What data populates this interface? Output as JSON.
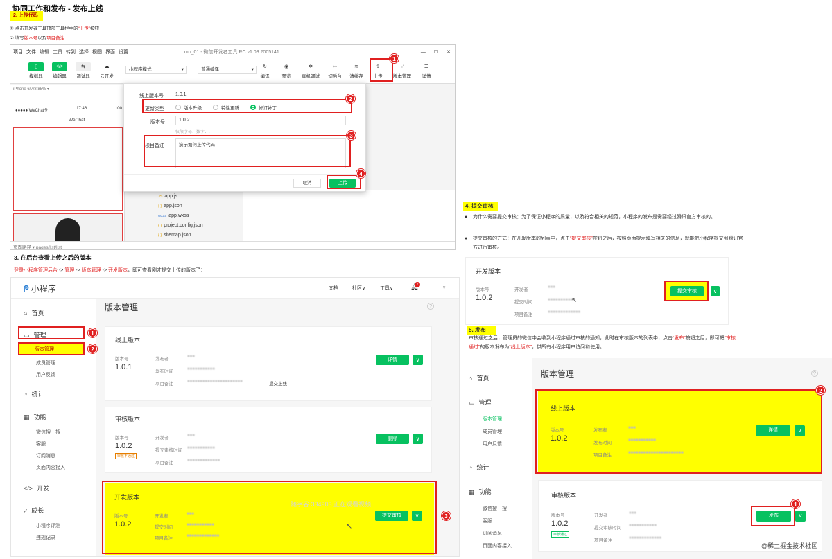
{
  "header": {
    "title": "协同工作和发布 - 发布上线",
    "step2": "2. 上传代码",
    "step2_note1_num": "①",
    "step2_note1_a": "点击开发者工具顶部工具栏中的",
    "step2_note1_b": "“上传”",
    "step2_note1_c": "按钮",
    "step2_note2_num": "②",
    "step2_note2_a": "填写",
    "step2_note2_b": "版本号",
    "step2_note2_c": "以及",
    "step2_note2_d": "项目备注"
  },
  "ide": {
    "menus": [
      "项目",
      "文件",
      "编辑",
      "工具",
      "转到",
      "选择",
      "视图",
      "界面",
      "设置",
      "..."
    ],
    "title": "mp_01 - 微信开发者工具 RC v1.03.2005141",
    "tools_left": [
      "模拟器",
      "编辑器",
      "调试器",
      "云开发"
    ],
    "mode": "小程序模式",
    "compile": "普通编译",
    "tools_right": [
      "编译",
      "预览",
      "真机调试",
      "切后台",
      "清缓存",
      "上传",
      "版本管理",
      "详情"
    ],
    "device": "iPhone 6/7/8 85% ▾",
    "wechat_carrier": "●●●●● WeChat令",
    "wechat_time": "17:46",
    "wechat_pct": "100",
    "wechat_title": "WeChat",
    "files": [
      "app.js",
      "app.json",
      "app.wxss",
      "project.config.json",
      "sitemap.json"
    ],
    "file_prefix": [
      "JS",
      "{ }",
      "wxss",
      "{ }",
      "{ }"
    ],
    "status": "页面路径 ▾   pages/list/list"
  },
  "dialog": {
    "online_label": "线上版本号",
    "online_val": "1.0.1",
    "type_label": "更新类型",
    "types": [
      "版本升级",
      "特性更新",
      "修订补丁"
    ],
    "ver_label": "版本号",
    "ver_val": "1.0.2",
    "ver_hint": "仅限字母、数字、.",
    "note_label": "项目备注",
    "note_val": "演示如何上传代码",
    "cancel": "取消",
    "upload": "上传"
  },
  "section3": {
    "title": "3. 在后台查看上传之后的版本",
    "path_a": "登录小程序管理后台",
    "path_b": "->",
    "path_c": "管理",
    "path_d": "->",
    "path_e": "版本管理",
    "path_f": "->",
    "path_g": "开发版本",
    "path_h": "，即可查看刚才提交上传的版本了："
  },
  "mp": {
    "logo": "小程序",
    "top": [
      "文档",
      "社区",
      "工具"
    ],
    "badge": "2",
    "sidebar": {
      "home": "首页",
      "manage": "管理",
      "manage_items": [
        "版本管理",
        "成员管理",
        "用户反馈"
      ],
      "stats": "统计",
      "func": "功能",
      "func_items": [
        "微信搜一搜",
        "客服",
        "订阅消息",
        "页面内容接入"
      ],
      "dev": "开发",
      "grow": "成长",
      "grow_items": [
        "小程序评测",
        "违规记录"
      ]
    },
    "page_title": "版本管理",
    "online": {
      "title": "线上版本",
      "ver_label": "版本号",
      "ver": "1.0.1",
      "publisher": "发布者",
      "time": "发布时间",
      "note": "项目备注",
      "note_suffix": "提交上线",
      "btn": "详情"
    },
    "audit": {
      "title": "审核版本",
      "ver_label": "版本号",
      "ver": "1.0.2",
      "tag": "审核不通过",
      "dev": "开发者",
      "time": "提交审核时间",
      "note": "项目备注",
      "btn": "删除"
    },
    "dev": {
      "title": "开发版本",
      "ver_label": "版本号",
      "ver": "1.0.2",
      "dev": "开发者",
      "time": "提交时间",
      "note": "项目备注",
      "btn": "提交审核",
      "watermark": "随字谷 334903 正在观看视频"
    }
  },
  "section4": {
    "title": "4. 提交审核",
    "b1": "为什么需要提交审核：为了保证小程序的质量，以及符合相关的规范，小程序的发布是需要经过腾讯官方审核的。",
    "b2a": "提交审核的方式：在开发版本的列表中，点击",
    "b2b": "“提交审核”",
    "b2c": "按钮之后，按照页面提示填写相关的信息，就能把小程序提交到腾讯官方进行审核。",
    "card_title": "开发版本",
    "ver_label": "版本号",
    "ver": "1.0.2",
    "dev": "开发者",
    "time": "提交时间",
    "note": "项目备注",
    "btn": "提交审核"
  },
  "section5": {
    "title": "5. 发布",
    "p_a": "审核通过之后，管理员的微信中会收到小程序通过审核的通知，此时在审核版本的列表中，点击",
    "p_b": "“发布”",
    "p_c": "按钮之后，即可把",
    "p_d": "“审核通过”",
    "p_e": "的版本发布为",
    "p_f": "“线上版本”",
    "p_g": "，供所有小程序用户访问和使用。"
  },
  "mp2": {
    "sidebar": {
      "home": "首页",
      "manage": "管理",
      "manage_items": [
        "版本管理",
        "成员管理",
        "用户反馈"
      ],
      "stats": "统计",
      "func": "功能",
      "func_items": [
        "微信搜一搜",
        "客服",
        "订阅消息",
        "页面内容接入"
      ]
    },
    "page_title": "版本管理",
    "online": {
      "title": "线上版本",
      "ver_label": "版本号",
      "ver": "1.0.2",
      "publisher": "发布者",
      "time": "发布时间",
      "note": "项目备注",
      "btn": "详情"
    },
    "audit": {
      "title": "审核版本",
      "ver_label": "版本号",
      "ver": "1.0.2",
      "tag": "审核通过",
      "dev": "开发者",
      "time": "提交审核时间",
      "note": "项目备注",
      "btn": "发布"
    }
  },
  "footer": {
    "watermark": "@稀土掘金技术社区"
  },
  "colors": {
    "accent": "#07c160",
    "highlight": "#ffff00",
    "annotation": "#e02020"
  }
}
